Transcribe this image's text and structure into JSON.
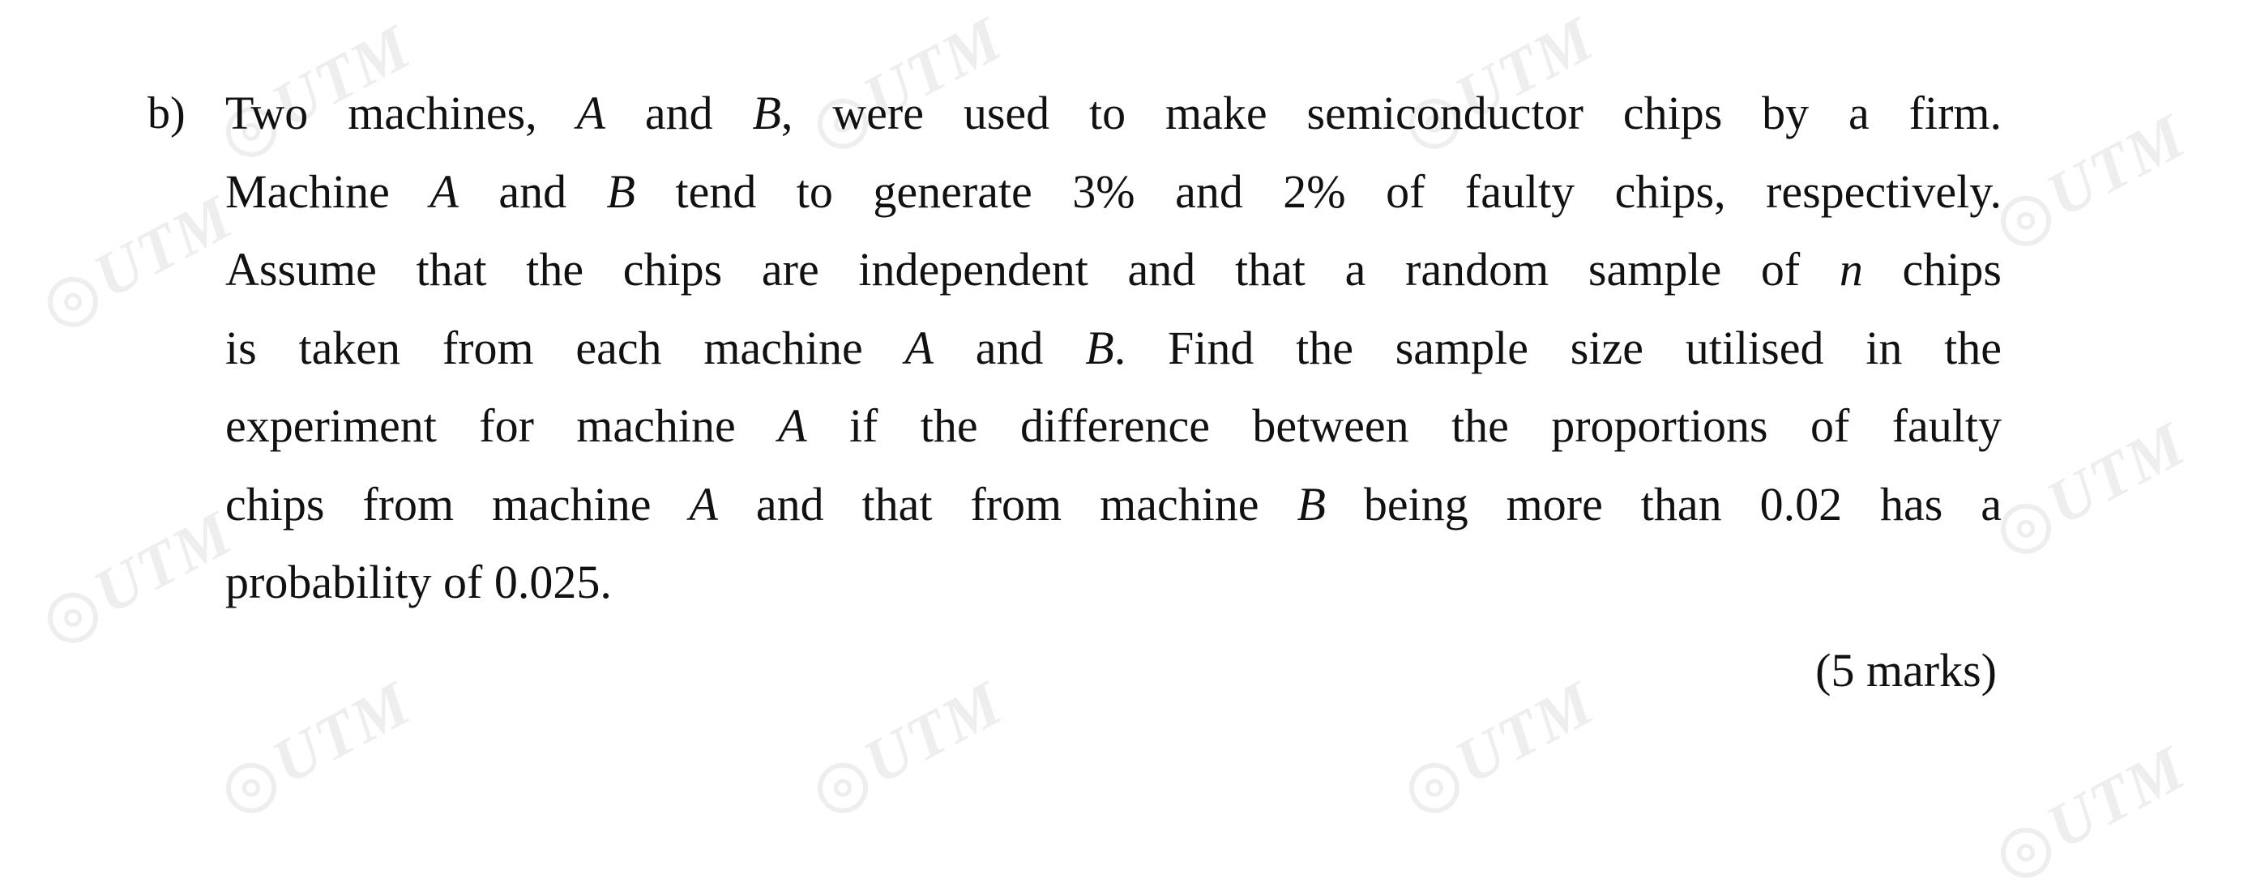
{
  "question": {
    "label": "b)",
    "lines": [
      "Two machines, A and B, were used to make semiconductor chips by a firm.",
      "Machine A and B tend to generate 3% and 2% of faulty chips, respectively.",
      "Assume that the chips are independent and that a random sample of n chips",
      "is taken from each machine A and B.  Find the sample size utilised in the",
      "experiment for machine A if the difference between the proportions of faulty",
      "chips from machine A and that from machine B being more than 0.02 has a",
      "probability of 0.025."
    ],
    "marks": "(5 marks)"
  },
  "watermark": {
    "text": "UTM",
    "icon": "utm-seal-icon"
  }
}
